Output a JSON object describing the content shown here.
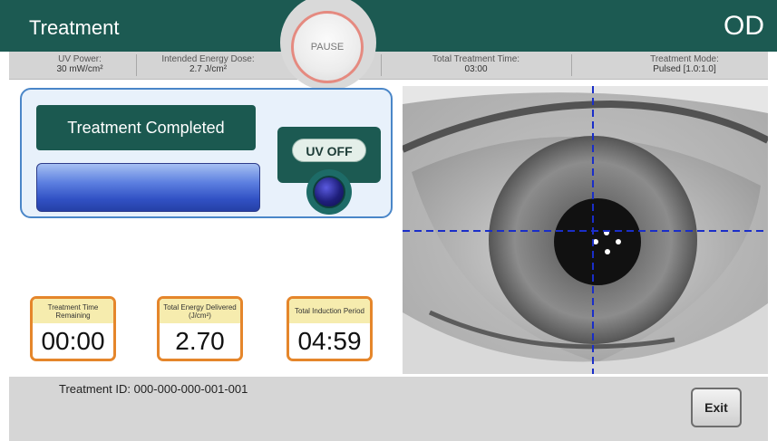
{
  "header": {
    "title": "Treatment",
    "eye_side": "OD"
  },
  "info": {
    "uv_power_label": "UV Power:",
    "uv_power_value": "30 mW/cm²",
    "energy_dose_label": "Intended Energy Dose:",
    "energy_dose_value": "2.7 J/cm²",
    "treatment_time_label": "Total Treatment Time:",
    "treatment_time_value": "03:00",
    "mode_label": "Treatment Mode:",
    "mode_value": "Pulsed [1.0:1.0]"
  },
  "pause_label": "PAUSE",
  "status": {
    "text": "Treatment Completed",
    "progress": 1.0
  },
  "uv": {
    "label": "UV OFF"
  },
  "metrics": [
    {
      "label": "Treatment Time Remaining",
      "value": "00:00"
    },
    {
      "label": "Total Energy Delivered (J/cm²)",
      "value": "2.70"
    },
    {
      "label": "Total Induction Period",
      "value": "04:59"
    }
  ],
  "footer": {
    "treatment_id": "Treatment ID: 000-000-000-001-001",
    "exit_label": "Exit"
  },
  "colors": {
    "header": "#1c5a52",
    "accent_orange": "#e5862b",
    "crosshair": "#1a2ec8",
    "panel_border": "#4a86c8"
  },
  "icons": {
    "uv_indicator": "uv-light-icon",
    "eye_image": "eye-camera-view"
  }
}
